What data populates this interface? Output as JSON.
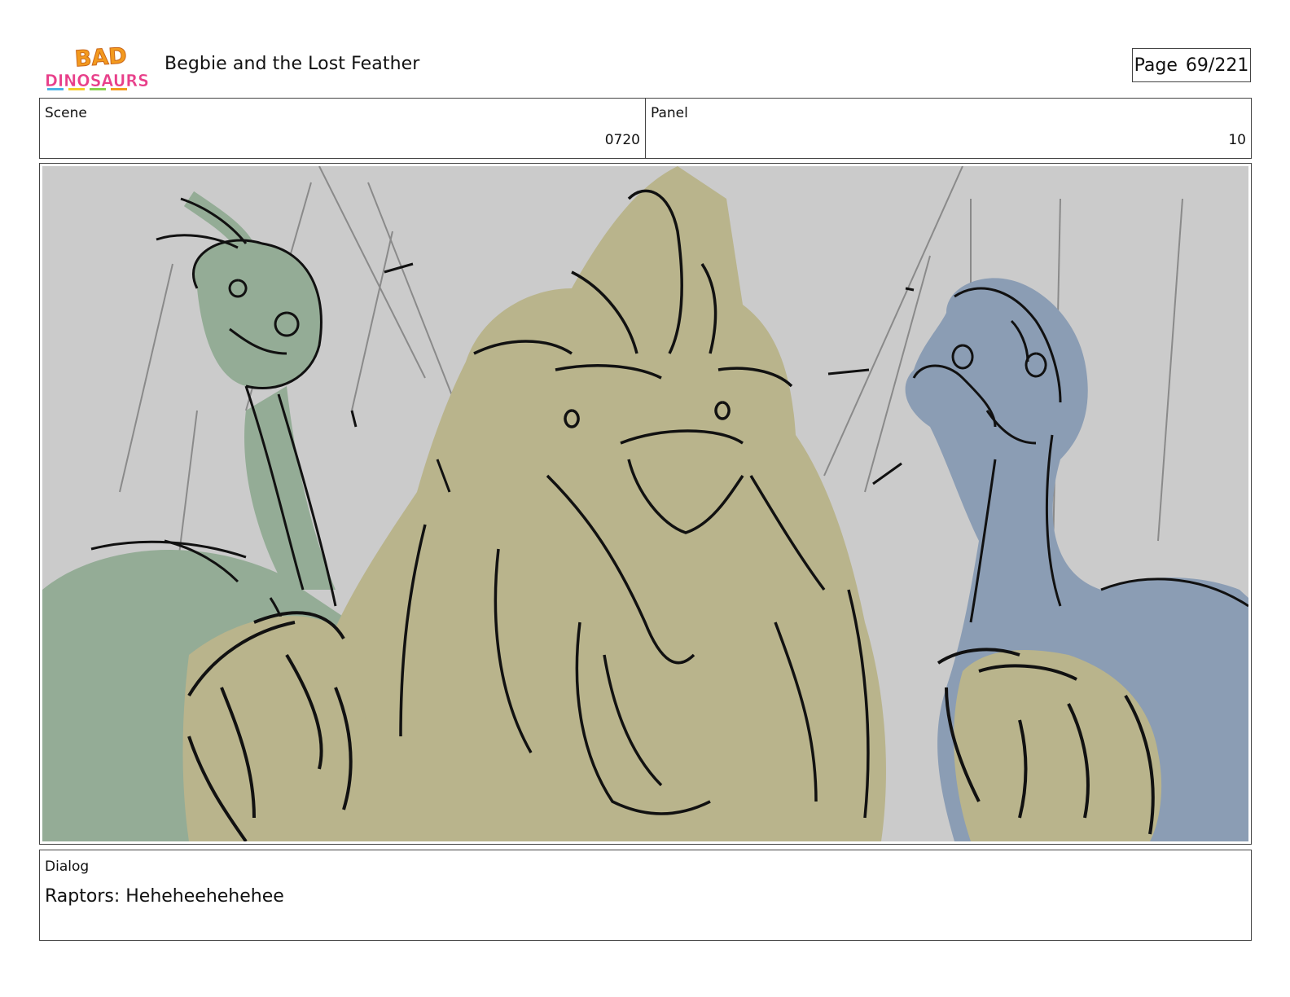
{
  "header": {
    "logo_text_line1": "BAD",
    "logo_text_line2": "DINOSAURS",
    "title": "Begbie and the Lost Feather",
    "page_label": "Page",
    "page_value": "69/221"
  },
  "meta": {
    "scene_label": "Scene",
    "scene_value": "0720",
    "panel_label": "Panel",
    "panel_value": "10"
  },
  "dialog": {
    "label": "Dialog",
    "text": "Raptors: Heheheehehehee"
  },
  "colors": {
    "background": "#cbcbcb",
    "green_raptor": "#94ac96",
    "tan_raptor": "#b9b48c",
    "blue_raptor": "#8b9db4",
    "line": "#111111",
    "logo_orange": "#f39a1e",
    "logo_pink": "#e83f8a",
    "logo_blue": "#4bb3e6",
    "logo_yellow": "#f6cd2a"
  }
}
